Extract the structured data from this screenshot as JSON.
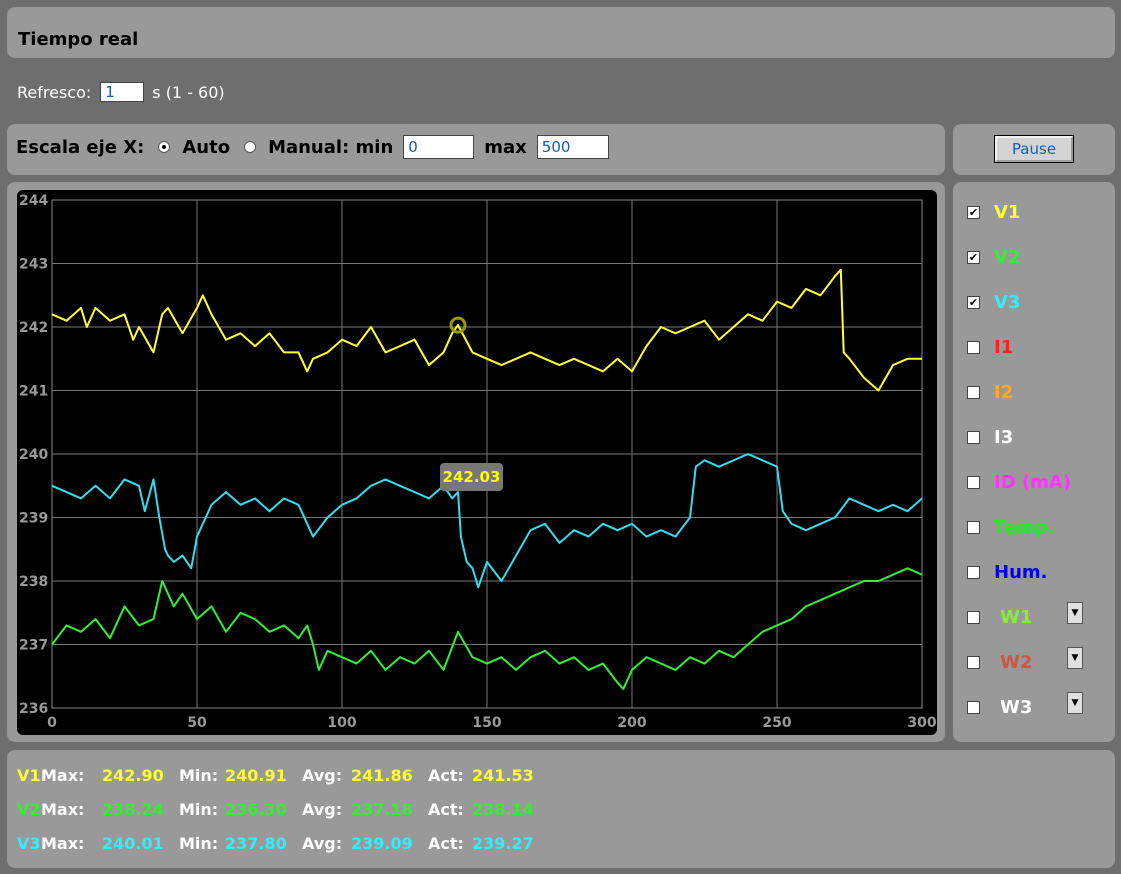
{
  "header": {
    "title": "Tiempo real"
  },
  "refresh": {
    "label": "Refresco:",
    "value": "1",
    "unit": "s (1 - 60)"
  },
  "scale": {
    "label": "Escala eje X:",
    "auto_label": "Auto",
    "manual_label": "Manual: min",
    "min_value": "0",
    "max_label": "max",
    "max_value": "500",
    "mode": "Auto"
  },
  "pause_label": "Pause",
  "chart_data": {
    "type": "line",
    "xlim": [
      0,
      300
    ],
    "ylim": [
      236,
      244
    ],
    "x_ticks": [
      "0",
      "50",
      "100",
      "150",
      "200",
      "250",
      "300"
    ],
    "y_ticks": [
      "244",
      "243",
      "242",
      "241",
      "240",
      "239",
      "238",
      "237",
      "236"
    ],
    "grid": true,
    "tooltip": "242.03",
    "series": [
      {
        "name": "V1",
        "color": "#ffff33",
        "x": [
          0,
          5,
          10,
          12,
          15,
          20,
          25,
          28,
          30,
          35,
          38,
          40,
          45,
          50,
          52,
          55,
          60,
          65,
          70,
          75,
          80,
          85,
          88,
          90,
          95,
          100,
          105,
          110,
          115,
          120,
          125,
          130,
          135,
          138,
          140,
          145,
          150,
          155,
          160,
          165,
          170,
          175,
          180,
          185,
          190,
          195,
          200,
          205,
          210,
          215,
          220,
          225,
          230,
          235,
          240,
          245,
          250,
          255,
          260,
          265,
          270,
          272,
          273,
          275,
          280,
          285,
          290,
          295,
          300
        ],
        "y": [
          242.2,
          242.1,
          242.3,
          242.0,
          242.3,
          242.1,
          242.2,
          241.8,
          242.0,
          241.6,
          242.2,
          242.3,
          241.9,
          242.3,
          242.5,
          242.2,
          241.8,
          241.9,
          241.7,
          241.9,
          241.6,
          241.6,
          241.3,
          241.5,
          241.6,
          241.8,
          241.7,
          242.0,
          241.6,
          241.7,
          241.8,
          241.4,
          241.6,
          241.9,
          242.03,
          241.6,
          241.5,
          241.4,
          241.5,
          241.6,
          241.5,
          241.4,
          241.5,
          241.4,
          241.3,
          241.5,
          241.3,
          241.7,
          242.0,
          241.9,
          242.0,
          242.1,
          241.8,
          242.0,
          242.2,
          242.1,
          242.4,
          242.3,
          242.6,
          242.5,
          242.8,
          242.9,
          241.6,
          241.5,
          241.2,
          241.0,
          241.4,
          241.5,
          241.5
        ]
      },
      {
        "name": "V2",
        "color": "#33ee33",
        "x": [
          0,
          5,
          10,
          15,
          20,
          25,
          30,
          35,
          38,
          40,
          42,
          45,
          50,
          55,
          60,
          65,
          70,
          75,
          80,
          85,
          88,
          90,
          92,
          95,
          100,
          105,
          110,
          115,
          120,
          125,
          130,
          135,
          140,
          145,
          150,
          155,
          160,
          165,
          170,
          175,
          180,
          185,
          190,
          195,
          197,
          200,
          205,
          210,
          215,
          220,
          225,
          230,
          235,
          240,
          245,
          250,
          255,
          260,
          265,
          270,
          275,
          280,
          285,
          290,
          295,
          300
        ],
        "y": [
          237.0,
          237.3,
          237.2,
          237.4,
          237.1,
          237.6,
          237.3,
          237.4,
          238.0,
          237.8,
          237.6,
          237.8,
          237.4,
          237.6,
          237.2,
          237.5,
          237.4,
          237.2,
          237.3,
          237.1,
          237.3,
          237.0,
          236.6,
          236.9,
          236.8,
          236.7,
          236.9,
          236.6,
          236.8,
          236.7,
          236.9,
          236.6,
          237.2,
          236.8,
          236.7,
          236.8,
          236.6,
          236.8,
          236.9,
          236.7,
          236.8,
          236.6,
          236.7,
          236.4,
          236.3,
          236.6,
          236.8,
          236.7,
          236.6,
          236.8,
          236.7,
          236.9,
          236.8,
          237.0,
          237.2,
          237.3,
          237.4,
          237.6,
          237.7,
          237.8,
          237.9,
          238.0,
          238.0,
          238.1,
          238.2,
          238.1
        ]
      },
      {
        "name": "V3",
        "color": "#33ddee",
        "x": [
          0,
          5,
          10,
          15,
          20,
          25,
          30,
          32,
          35,
          37,
          39,
          40,
          42,
          45,
          48,
          50,
          55,
          60,
          65,
          70,
          75,
          80,
          85,
          88,
          90,
          95,
          100,
          105,
          110,
          115,
          120,
          125,
          130,
          135,
          138,
          140,
          141,
          143,
          145,
          147,
          150,
          155,
          160,
          165,
          170,
          175,
          180,
          185,
          190,
          195,
          200,
          205,
          210,
          215,
          220,
          222,
          225,
          230,
          235,
          240,
          245,
          250,
          252,
          255,
          260,
          265,
          270,
          275,
          280,
          285,
          290,
          295,
          300
        ],
        "y": [
          239.5,
          239.4,
          239.3,
          239.5,
          239.3,
          239.6,
          239.5,
          239.1,
          239.6,
          239.0,
          238.5,
          238.4,
          238.3,
          238.4,
          238.2,
          238.7,
          239.2,
          239.4,
          239.2,
          239.3,
          239.1,
          239.3,
          239.2,
          238.9,
          238.7,
          239.0,
          239.2,
          239.3,
          239.5,
          239.6,
          239.5,
          239.4,
          239.3,
          239.5,
          239.3,
          239.4,
          238.7,
          238.3,
          238.2,
          237.9,
          238.3,
          238.0,
          238.4,
          238.8,
          238.9,
          238.6,
          238.8,
          238.7,
          238.9,
          238.8,
          238.9,
          238.7,
          238.8,
          238.7,
          239.0,
          239.8,
          239.9,
          239.8,
          239.9,
          240.0,
          239.9,
          239.8,
          239.1,
          238.9,
          238.8,
          238.9,
          239.0,
          239.3,
          239.2,
          239.1,
          239.2,
          239.1,
          239.3
        ]
      }
    ]
  },
  "series_toggles": [
    {
      "label": "V1",
      "checked": true,
      "color": "#ffff33"
    },
    {
      "label": "V2",
      "checked": true,
      "color": "#33ee33"
    },
    {
      "label": "V3",
      "checked": true,
      "color": "#33eeff"
    },
    {
      "label": "I1",
      "checked": false,
      "color": "#ff2222"
    },
    {
      "label": "I2",
      "checked": false,
      "color": "#ffaa22"
    },
    {
      "label": "I3",
      "checked": false,
      "color": "#ffffff"
    },
    {
      "label": "ID (mA)",
      "checked": false,
      "color": "#ff33ff"
    },
    {
      "label": "Temp.",
      "checked": false,
      "color": "#22ee22"
    },
    {
      "label": "Hum.",
      "checked": false,
      "color": "#0000ee"
    },
    {
      "label": "W1",
      "checked": false,
      "color": "#88ee33"
    },
    {
      "label": "W2",
      "checked": false,
      "color": "#cc5544"
    },
    {
      "label": "W3",
      "checked": false,
      "color": "#ffffff"
    }
  ],
  "stats": [
    {
      "name": "V1:",
      "color": "#ffff33",
      "max": "242.90",
      "min": "240.91",
      "avg": "241.86",
      "act": "241.53"
    },
    {
      "name": "V2:",
      "color": "#33ee33",
      "max": "238.24",
      "min": "236.30",
      "avg": "237.18",
      "act": "238.14"
    },
    {
      "name": "V3:",
      "color": "#33eeff",
      "max": "240.01",
      "min": "237.80",
      "avg": "239.09",
      "act": "239.27"
    }
  ],
  "stat_labels": {
    "max": "Max:",
    "min": "Min:",
    "avg": "Avg:",
    "act": "Act:"
  }
}
